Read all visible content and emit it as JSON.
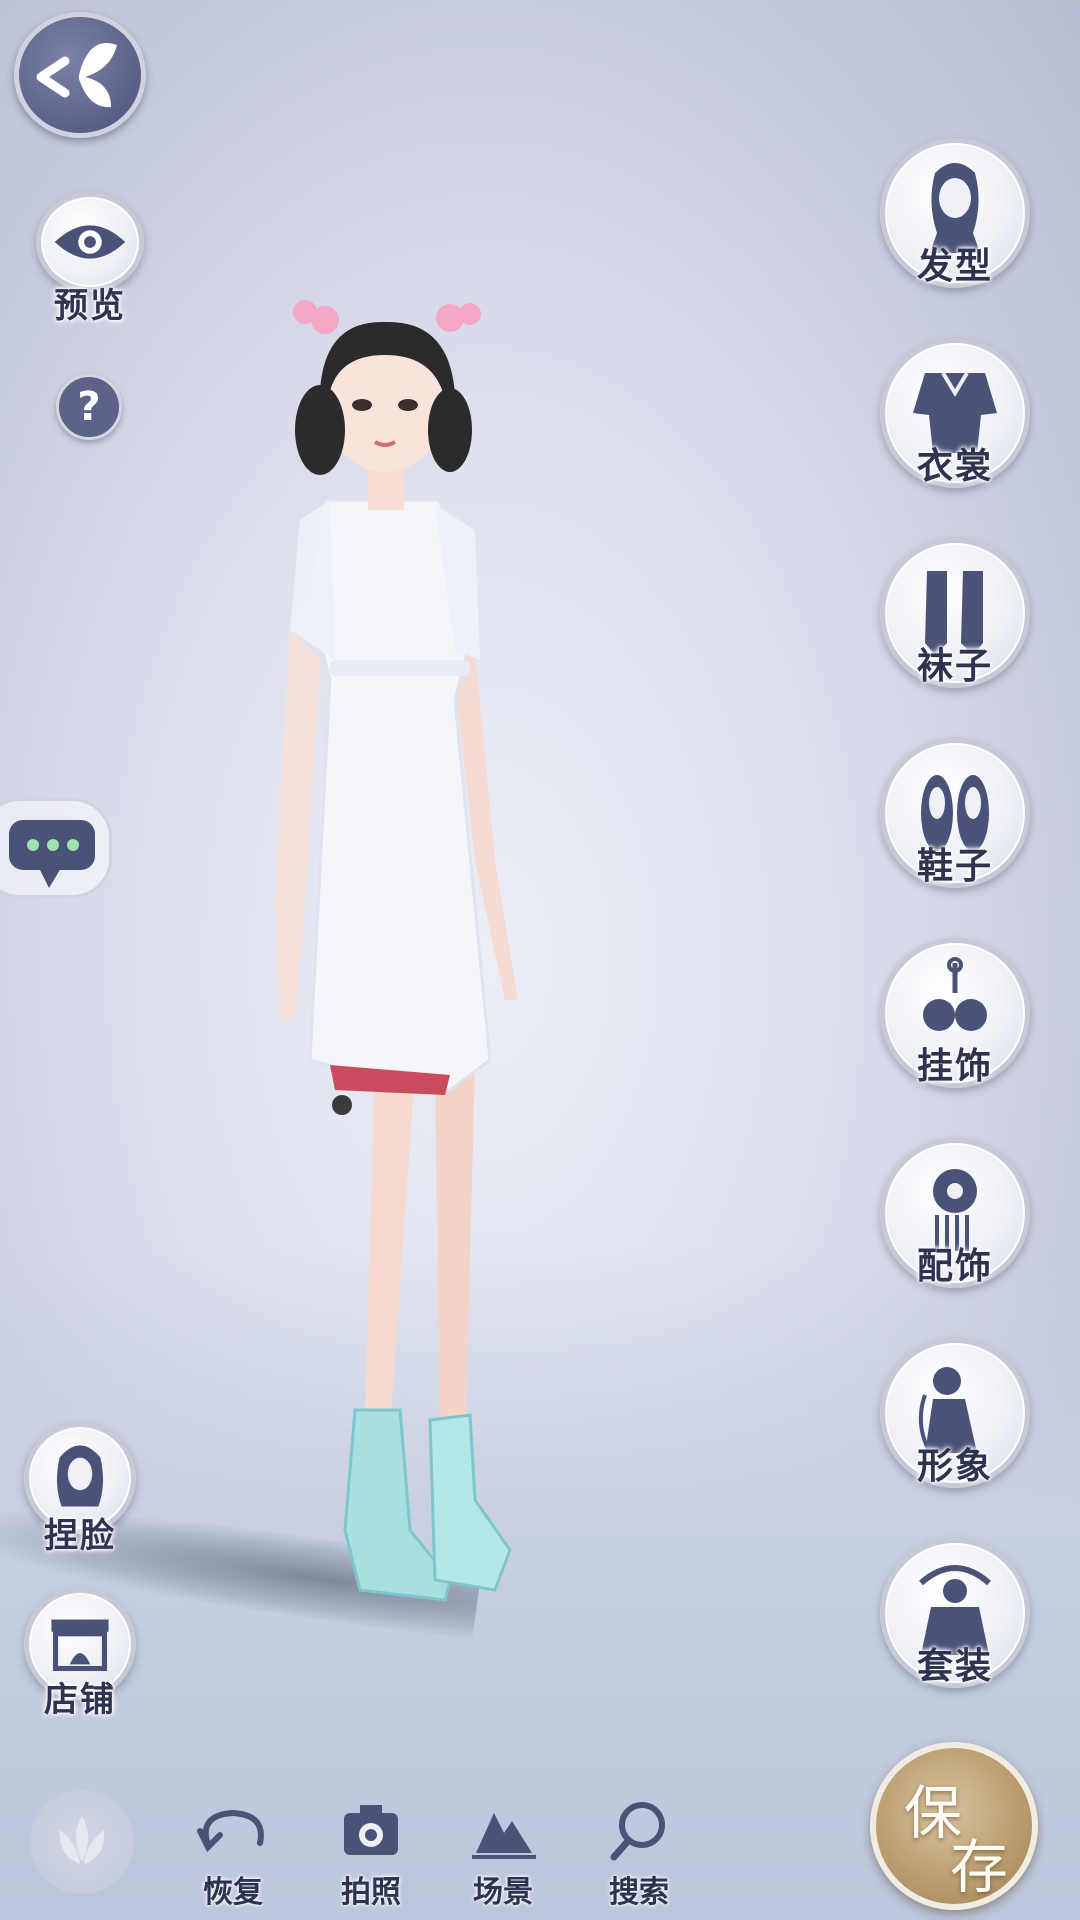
{
  "left_panel": {
    "back_button": "back",
    "preview_label": "预览",
    "help_symbol": "?",
    "face_label": "捏脸",
    "shop_label": "店铺"
  },
  "right_menu": {
    "items": [
      {
        "label": "发型",
        "icon": "hairstyle-icon"
      },
      {
        "label": "衣裳",
        "icon": "clothing-icon"
      },
      {
        "label": "袜子",
        "icon": "socks-icon"
      },
      {
        "label": "鞋子",
        "icon": "shoes-icon"
      },
      {
        "label": "挂饰",
        "icon": "pendant-icon"
      },
      {
        "label": "配饰",
        "icon": "accessory-icon"
      },
      {
        "label": "形象",
        "icon": "appearance-icon"
      },
      {
        "label": "套装",
        "icon": "outfit-set-icon"
      }
    ]
  },
  "bottom_bar": {
    "restore_label": "恢复",
    "photo_label": "拍照",
    "scene_label": "场景",
    "search_label": "搜索"
  },
  "save_button": {
    "char1": "保",
    "char2": "存"
  },
  "colors": {
    "icon": "#4b5278",
    "save": "#b99b6d",
    "text": "#2d3350"
  }
}
